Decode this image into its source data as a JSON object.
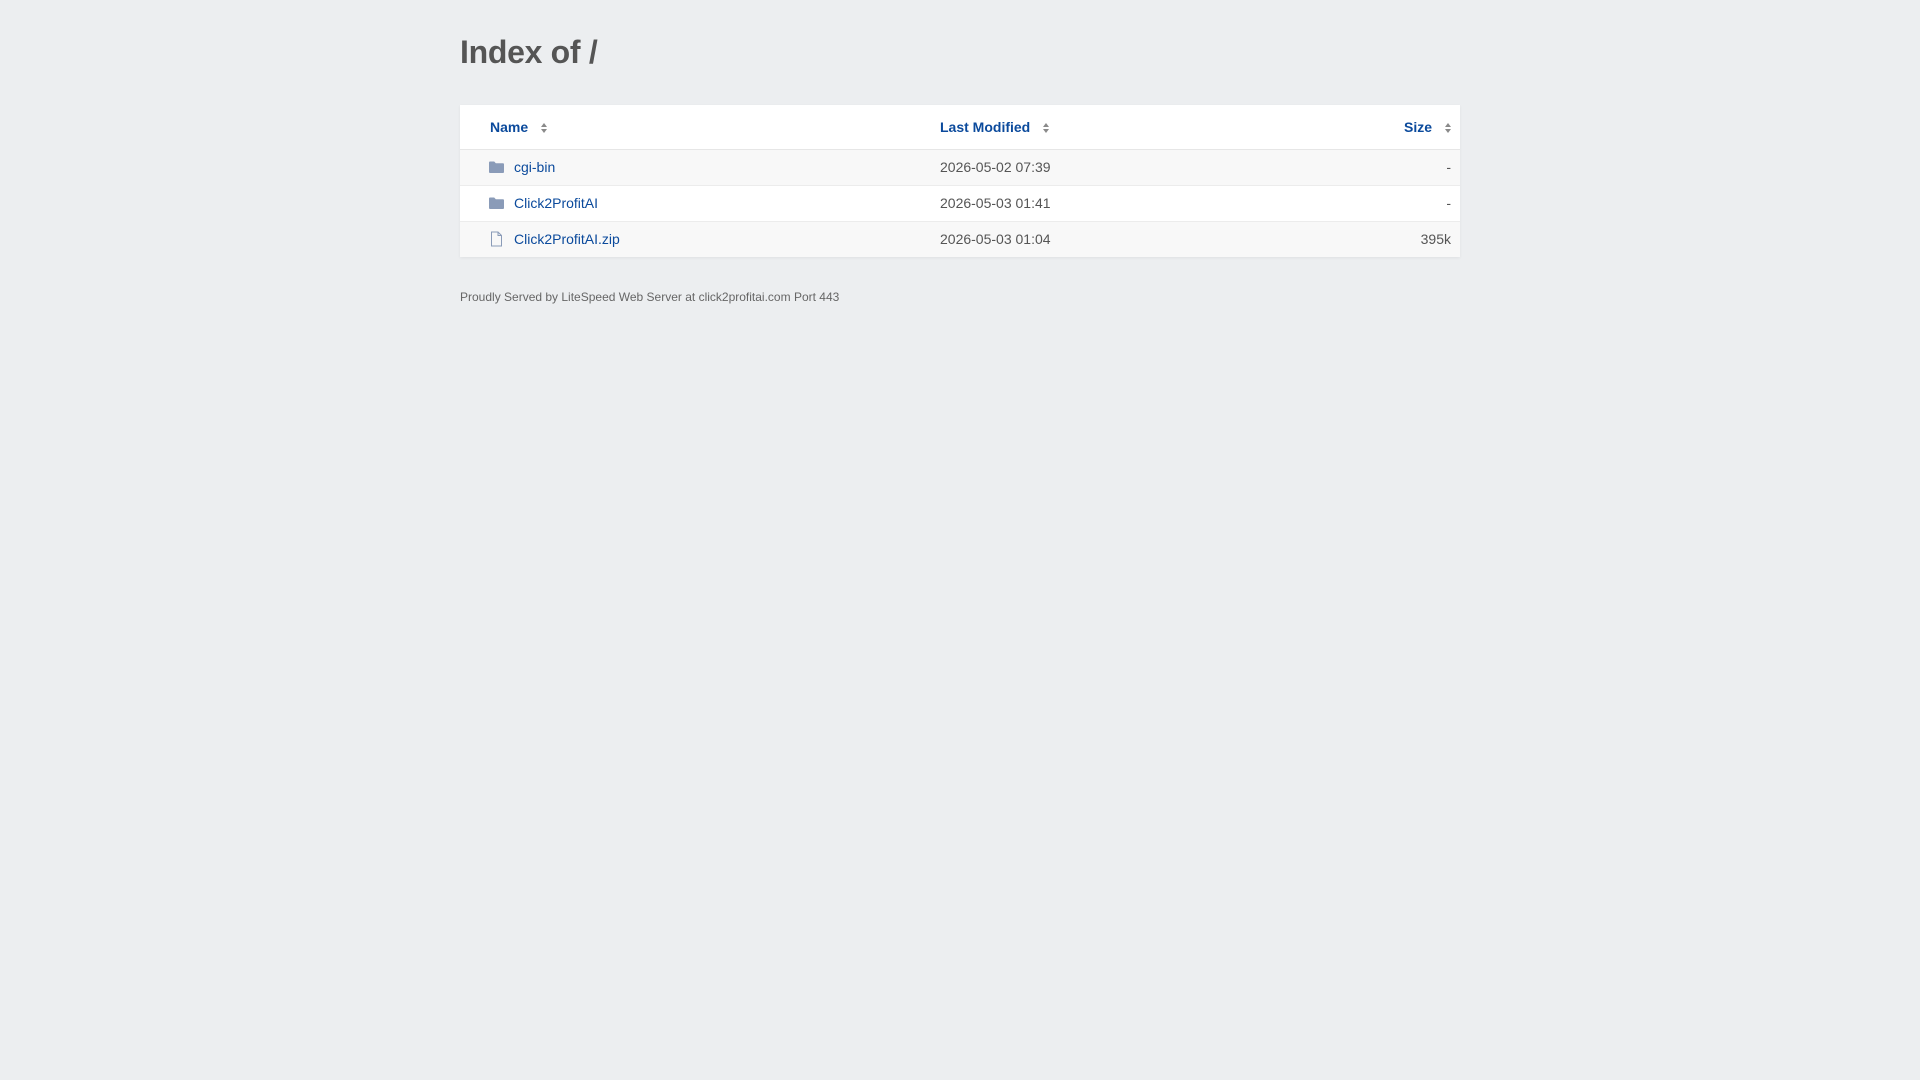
{
  "page": {
    "title": "Index of /"
  },
  "table": {
    "headers": {
      "name": "Name",
      "modified": "Last Modified",
      "size": "Size"
    },
    "rows": [
      {
        "icon": "folder-icon",
        "name": "cgi-bin",
        "modified": "2026-05-02 07:39",
        "size": "-"
      },
      {
        "icon": "folder-icon",
        "name": "Click2ProfitAI",
        "modified": "2026-05-03 01:41",
        "size": "-"
      },
      {
        "icon": "file-icon",
        "name": "Click2ProfitAI.zip",
        "modified": "2026-05-03 01:04",
        "size": "395k"
      }
    ]
  },
  "footer": {
    "text": "Proudly Served by LiteSpeed Web Server at click2profitai.com Port 443"
  },
  "colors": {
    "background": "#eceef0",
    "link": "#0b4a9c",
    "folder_icon": "#8a9bb8",
    "text": "#555555"
  }
}
